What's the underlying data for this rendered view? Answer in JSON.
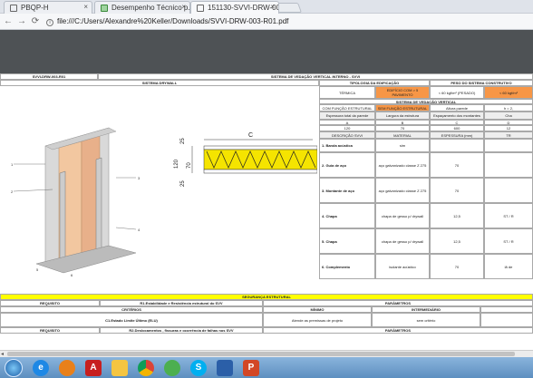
{
  "tabs": [
    {
      "label": "PBQP-H",
      "close": "×"
    },
    {
      "label": "Desempenho Técnico p...",
      "close": "×"
    },
    {
      "label": "151130-SVVI-DRW-003-",
      "close": "×"
    }
  ],
  "address": {
    "url": "file:///C:/Users/Alexandre%20Keller/Downloads/SVVI-DRW-003-R01.pdf"
  },
  "doc": {
    "code": "SVVI-DRW-003-R01",
    "title": "SISTEMA DE VEDAÇÃO VERTICAL INTERNO - SVVI",
    "system": "SISTEMA DRYWALL",
    "tipologia": "TIPOLOGIA DA EDIFICAÇÃO",
    "peso": "PESO DO SISTEMA CONSTRUTIVO",
    "termica": "TÉRMICA",
    "edificio": "EDIFÍCIO COM > 5 PAVIMENTO",
    "peso1": "< 60 kgf/m² (PESADO)",
    "peso2": "< 60 kgf/m²",
    "sistema_vedacao": "SISTEMA DE VEDAÇÃO VERTICAL",
    "com_funcao": "COM FUNÇÃO ESTRUTURAL",
    "sem_funcao": "SEM FUNÇÃO ESTRUTURAL",
    "altura": "Altura  parede",
    "h": "h = 2,",
    "esp_total": "Espessura total da parede",
    "largura": "Largura da estrutura",
    "espacamento": "Espaçamento dos montantes",
    "chapa_col": "Cha",
    "letters": [
      "A",
      "B",
      "C",
      "D"
    ],
    "vals": [
      "120",
      "70",
      "600",
      "12"
    ],
    "desc": "DESCRIÇÃO SVVI",
    "material": "MATERIAL",
    "espessura": "ESPESSURA (mm)",
    "tr": "TR",
    "rows": [
      {
        "d": "1. Banda acústica",
        "m": "sim",
        "e": "",
        "t": ""
      },
      {
        "d": "2. Guia de aço",
        "m": "aço galvanizado classe Z 275",
        "e": "70",
        "t": ""
      },
      {
        "d": "3. Montante de aço",
        "m": "aço galvanizado classe Z 275",
        "e": "70",
        "t": ""
      },
      {
        "d": "4. Chapa",
        "m": "chapa de gesso p/ drywall",
        "e": "12,5",
        "t": "ST / R"
      },
      {
        "d": "5. Chapa",
        "m": "chapa de gesso p/ drywall",
        "e": "12,5",
        "t": "ST / R"
      },
      {
        "d": "6. Complemento",
        "m": "isolante acústico",
        "e": "70",
        "t": "lã de"
      }
    ],
    "dims": {
      "c": "C",
      "d25a": "25",
      "d120": "120",
      "d70": "70",
      "d25b": "25"
    },
    "seguranca": "SEGURANÇA ESTRUTURAL",
    "requisito": "REQUISITO",
    "r1": "R1.Estabilidade e Resistência estrutural do SVV",
    "parametros": "PARÂMETROS",
    "criterios": "CRITÉRIOS",
    "minimo": "MÍNIMO",
    "intermediario": "INTERMEDIÁRIO",
    "c1": "C1.Estado Limite Último (ELU)",
    "atende": "Atende as premissas de projeto",
    "sem_criterio": "sem critério",
    "r2": "R2.Deslocamentos , fissuras e ocorrência de falhas nos SVV",
    "parametros2": "PARÂMETROS",
    "labels": [
      "1",
      "2",
      "3",
      "4",
      "5",
      "6"
    ]
  },
  "taskbar": [
    "start",
    "ie",
    "firefox",
    "acrobat",
    "folder",
    "chrome",
    "people",
    "skype",
    "shield",
    "powerpoint"
  ]
}
